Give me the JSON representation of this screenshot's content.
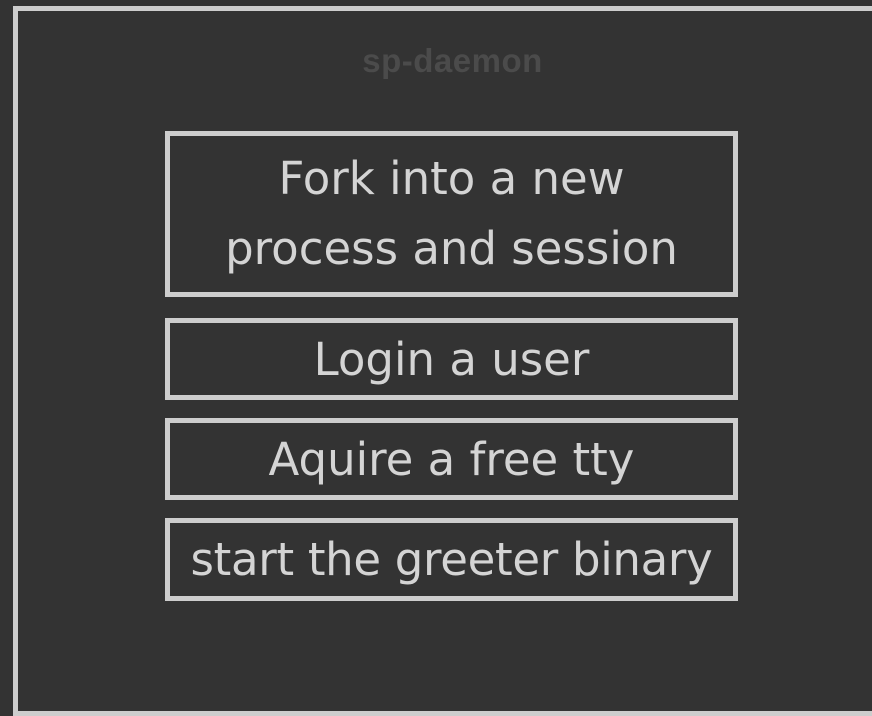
{
  "diagram": {
    "title": "sp-daemon",
    "steps": [
      {
        "label": "Fork into a new process and session"
      },
      {
        "label": "Login a user"
      },
      {
        "label": "Aquire a free tty"
      },
      {
        "label": "start the greeter binary"
      }
    ]
  },
  "colors": {
    "background": "#333333",
    "border": "#cdcdcd",
    "text": "#d4d4d4",
    "title": "#4b4b4b"
  }
}
